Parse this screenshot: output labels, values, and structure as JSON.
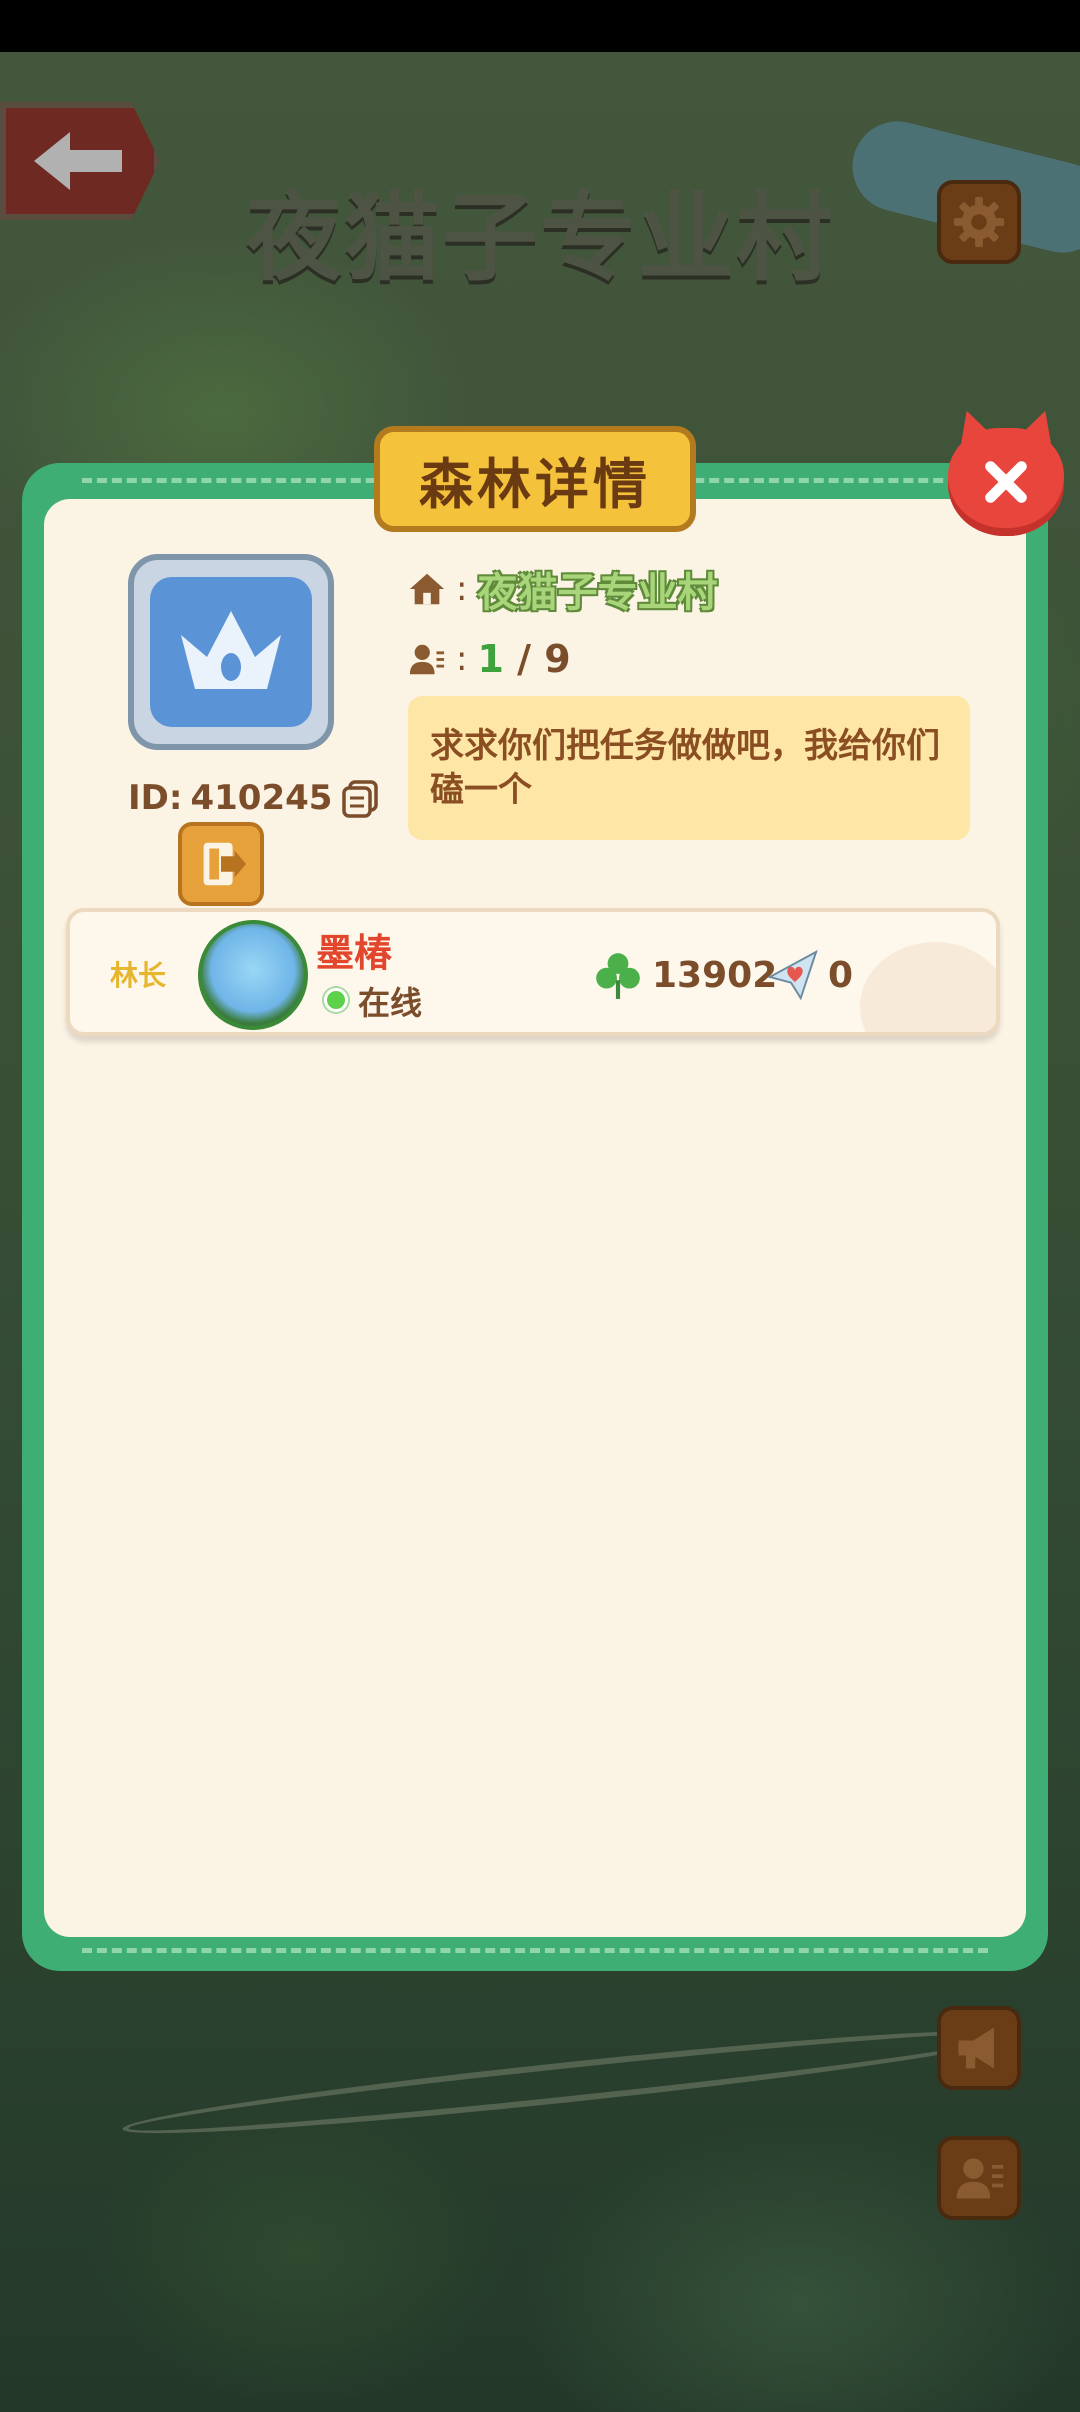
{
  "header": {
    "title": "夜猫子专业村"
  },
  "dialog": {
    "title": "森林详情",
    "forest": {
      "name": "夜猫子专业村",
      "members_current": "1",
      "members_separator": "/",
      "members_max": "9",
      "id_label": "ID:",
      "id_value": "410245",
      "announcement": "求求你们把任务做做吧，我给你们磕一个"
    },
    "info_colon": ":",
    "members": [
      {
        "role": "林长",
        "name": "墨椿",
        "status": "在线",
        "clover_score": "13902",
        "hearts": "0"
      }
    ]
  },
  "colors": {
    "modal_border": "#3fae74",
    "modal_bg": "#fbf3e4",
    "title_banner": "#f4c23b",
    "close_red": "#e8453c",
    "accent_text": "#7b4d2b"
  },
  "icons": {
    "back": "arrow-left-icon",
    "settings": "gear-icon",
    "close": "close-icon",
    "home": "home-icon",
    "members": "members-icon",
    "copy": "copy-icon",
    "leave": "exit-icon",
    "clover": "clover-icon",
    "heart_plane": "heart-paper-plane-icon",
    "megaphone": "megaphone-icon",
    "contacts": "contacts-icon"
  }
}
